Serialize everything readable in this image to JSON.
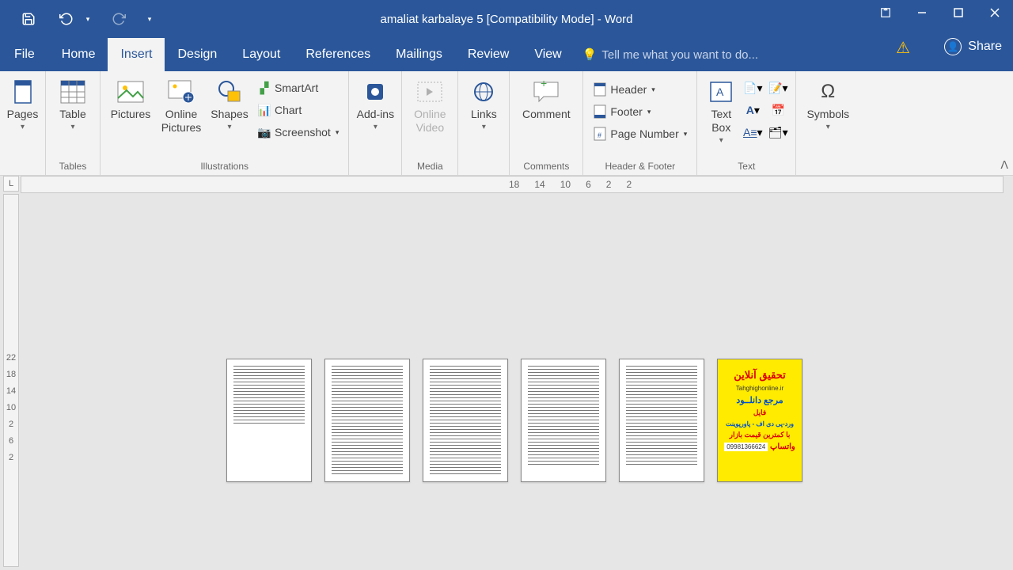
{
  "titlebar": {
    "title": "amaliat karbalaye 5 [Compatibility Mode] - Word"
  },
  "tabs": {
    "file": "File",
    "home": "Home",
    "insert": "Insert",
    "design": "Design",
    "layout": "Layout",
    "references": "References",
    "mailings": "Mailings",
    "review": "Review",
    "view": "View",
    "tellme": "Tell me what you want to do...",
    "share": "Share"
  },
  "ribbon": {
    "pages": "Pages",
    "tables": {
      "label": "Tables",
      "table": "Table"
    },
    "illustrations": {
      "label": "Illustrations",
      "pictures": "Pictures",
      "online_pictures": "Online Pictures",
      "shapes": "Shapes",
      "smartart": "SmartArt",
      "chart": "Chart",
      "screenshot": "Screenshot"
    },
    "addins": "Add-ins",
    "media": {
      "label": "Media",
      "online_video": "Online Video"
    },
    "links": "Links",
    "comments": {
      "label": "Comments",
      "comment": "Comment"
    },
    "headerfooter": {
      "label": "Header & Footer",
      "header": "Header",
      "footer": "Footer",
      "page_number": "Page Number"
    },
    "text": {
      "label": "Text",
      "text_box": "Text Box"
    },
    "symbols": "Symbols"
  },
  "ruler": {
    "h": [
      "18",
      "14",
      "10",
      "6",
      "2",
      "2"
    ],
    "v": [
      "2",
      "6",
      "2",
      "10",
      "14",
      "18",
      "22"
    ],
    "corner": "L"
  },
  "cover": {
    "title": "تحقیق آنلاین",
    "url": "Tahghighonline.ir",
    "sub": "مرجع دانلــود",
    "file": "فایل",
    "formats": "ورد-پی دی اف - پاورپوینت",
    "price": "با کمترین قیمت بازار",
    "phone": "09981366624",
    "wa": "واتساپ"
  }
}
